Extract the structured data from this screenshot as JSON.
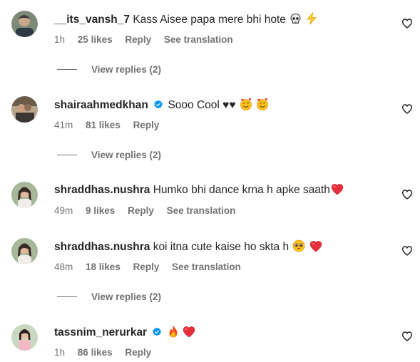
{
  "comments": [
    {
      "username": "__its_vansh_7",
      "text": "Kass Aisee papa mere bhi hote",
      "emojis": [
        "skull-emoji",
        "lightning-emoji"
      ],
      "verified": false,
      "time": "1h",
      "likes": "25 likes",
      "reply": "Reply",
      "translate": "See translation",
      "view_replies": "View replies (2)"
    },
    {
      "username": "shairaahmedkhan",
      "text": "Sooo Cool ♥♥",
      "emojis": [
        "smiling-face-with-hearts-emoji",
        "smiling-face-with-hearts-emoji"
      ],
      "verified": true,
      "time": "41m",
      "likes": "81 likes",
      "reply": "Reply",
      "translate": "",
      "view_replies": "View replies (2)"
    },
    {
      "username": "shraddhas.nushra",
      "text": "Humko bhi dance krna h apke saath",
      "emojis": [
        "red-heart-emoji"
      ],
      "verified": false,
      "time": "49m",
      "likes": "9 likes",
      "reply": "Reply",
      "translate": "See translation",
      "view_replies": ""
    },
    {
      "username": "shraddhas.nushra",
      "text": "koi itna cute kaise ho skta h",
      "emojis": [
        "pleading-face-emoji",
        "red-heart-emoji"
      ],
      "verified": false,
      "time": "48m",
      "likes": "18 likes",
      "reply": "Reply",
      "translate": "See translation",
      "view_replies": "View replies (2)"
    },
    {
      "username": "tassnim_nerurkar",
      "text": "",
      "emojis": [
        "fire-emoji",
        "red-heart-emoji"
      ],
      "verified": true,
      "time": "1h",
      "likes": "86 likes",
      "reply": "Reply",
      "translate": "",
      "view_replies": ""
    }
  ],
  "colors": {
    "text": "#262626",
    "secondary": "#737373",
    "verified": "#0095f6",
    "heart": "#ed4956"
  }
}
